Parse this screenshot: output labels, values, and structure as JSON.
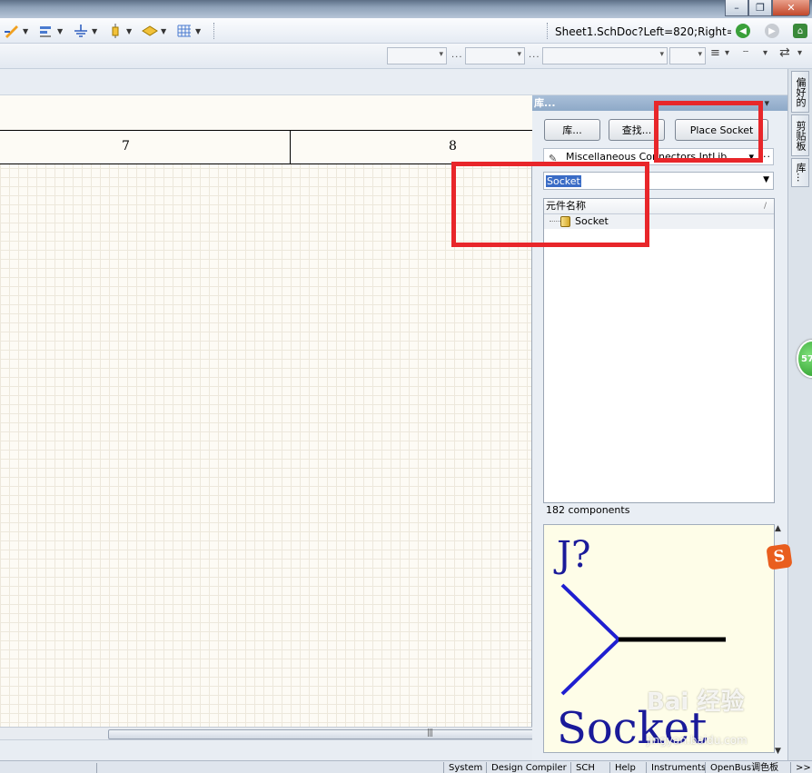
{
  "toolbar": {
    "document_address": "Sheet1.SchDoc?Left=820;Right="
  },
  "sheet": {
    "zone_labels": [
      "7",
      "8"
    ]
  },
  "library_panel": {
    "title": "库...",
    "btn_libraries": "库...",
    "btn_search": "查找...",
    "btn_place": "Place Socket",
    "library_selected": "Miscellaneous Connectors.IntLib",
    "filter_value": "Socket",
    "column_header": "元件名称",
    "components": [
      {
        "name": "Socket"
      }
    ],
    "component_count": "182 components",
    "preview": {
      "designator": "J?",
      "comment": "Socket"
    }
  },
  "dock_tabs": [
    "偏好的",
    "剪贴板",
    "库..."
  ],
  "statusbar": {
    "items": [
      "System",
      "Design Compiler",
      "SCH",
      "Help",
      "Instruments",
      "OpenBus调色板",
      ">>"
    ]
  },
  "overlays": {
    "badge_text": "57",
    "sogou_letter": "S",
    "watermark_brand": "Bai 经验",
    "watermark_url": "jingyan.baidu.com"
  },
  "colors": {
    "annotation": "#e8262a",
    "schematic_blue": "#1f1fd0",
    "selection": "#3a6cc6"
  }
}
